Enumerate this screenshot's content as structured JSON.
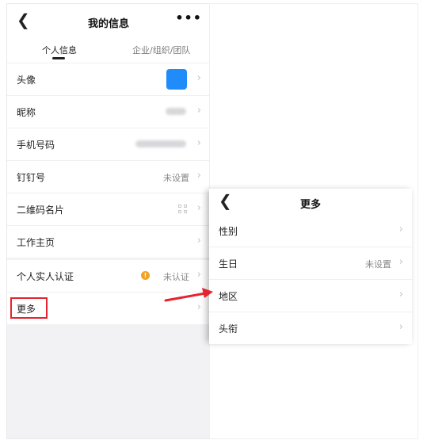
{
  "left_screen": {
    "nav": {
      "back_icon": "chevron-left-icon",
      "title": "我的信息",
      "more_icon": "more-horizontal-icon",
      "more_glyph": "•••"
    },
    "tabs": {
      "active": "个人信息",
      "inactive": "企业/组织/团队"
    },
    "rows": [
      {
        "label": "头像",
        "kind": "avatar",
        "avatar_color": "#1f8cfa"
      },
      {
        "label": "昵称",
        "kind": "blurred"
      },
      {
        "label": "手机号码",
        "kind": "blurred"
      },
      {
        "label": "钉钉号",
        "kind": "text",
        "value": "未设置"
      },
      {
        "label": "二维码名片",
        "kind": "qr"
      },
      {
        "label": "工作主页",
        "kind": "none"
      }
    ],
    "rows2": [
      {
        "label": "个人实人认证",
        "value": "未认证",
        "status_color": "#f2a122"
      },
      {
        "label": "更多",
        "highlight_color": "#e4242e"
      }
    ],
    "chevron": "›"
  },
  "popup": {
    "nav": {
      "back_icon": "chevron-left-icon",
      "title": "更多"
    },
    "rows": [
      {
        "label": "性别",
        "value": ""
      },
      {
        "label": "生日",
        "value": "未设置"
      },
      {
        "label": "地区",
        "value": ""
      },
      {
        "label": "头衔",
        "value": ""
      }
    ]
  },
  "annotation": {
    "arrow_color": "#e4242e"
  }
}
